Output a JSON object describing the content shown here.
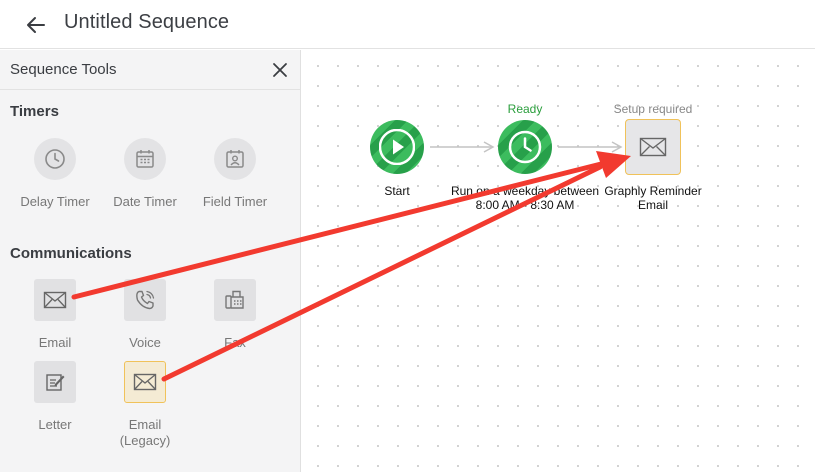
{
  "header": {
    "title": "Untitled Sequence"
  },
  "sidebar": {
    "title": "Sequence Tools",
    "sections": {
      "timers": {
        "title": "Timers",
        "items": [
          {
            "label": "Delay Timer",
            "icon": "clock-icon"
          },
          {
            "label": "Date Timer",
            "icon": "calendar-icon"
          },
          {
            "label": "Field Timer",
            "icon": "calendar-person-icon"
          }
        ]
      },
      "communications": {
        "title": "Communications",
        "items": [
          {
            "label": "Email",
            "icon": "envelope-icon"
          },
          {
            "label": "Voice",
            "icon": "phone-icon"
          },
          {
            "label": "Fax",
            "icon": "fax-icon"
          },
          {
            "label": "Letter",
            "icon": "letter-icon"
          },
          {
            "label": "Email",
            "label2": "(Legacy)",
            "icon": "envelope-icon"
          }
        ]
      }
    }
  },
  "canvas": {
    "nodes": [
      {
        "label": "Start",
        "icon": "play-icon"
      },
      {
        "status": "Ready",
        "label": "Run on a weekday between",
        "label2": "8:00 AM - 8:30 AM",
        "icon": "clock-icon"
      },
      {
        "status": "Setup required",
        "label": "Graphly Reminder",
        "label2": "Email",
        "icon": "envelope-icon"
      }
    ]
  },
  "colors": {
    "accent_green": "#2ea84f",
    "warning_border": "#f0c25a",
    "annotation_red": "#f23a2f",
    "status_ready": "#2a9e3c",
    "status_setup": "#888888"
  }
}
